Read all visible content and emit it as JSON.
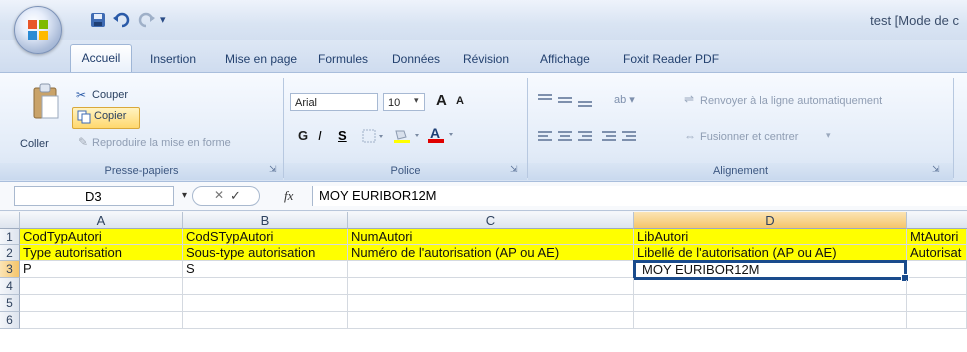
{
  "titlebar": {
    "title": "test [Mode de c",
    "qa_sep": "▾"
  },
  "tabs": [
    "Accueil",
    "Insertion",
    "Mise en page",
    "Formules",
    "Données",
    "Révision",
    "Affichage",
    "Foxit Reader PDF"
  ],
  "ribbon": {
    "clipboard": {
      "paste": "Coller",
      "cut": "Couper",
      "copy": "Copier",
      "format_painter": "Reproduire la mise en forme",
      "label": "Presse-papiers"
    },
    "font": {
      "name": "Arial",
      "size": "10",
      "grow": "A",
      "shrink": "A",
      "bold": "G",
      "italic": "I",
      "underline": "S",
      "label": "Police"
    },
    "alignment": {
      "wrap": "Renvoyer à la ligne automatiquement",
      "merge": "Fusionner et centrer",
      "label": "Alignement"
    }
  },
  "formula": {
    "cell_ref": "D3",
    "cancel": "✕",
    "enter": "✓",
    "fx": "fx",
    "value": "MOY EURIBOR12M"
  },
  "columns": [
    "A",
    "B",
    "C",
    "D"
  ],
  "rows": [
    "1",
    "2",
    "3",
    "4",
    "5",
    "6"
  ],
  "cells": {
    "r1": [
      "CodTypAutori",
      "CodSTypAutori",
      "NumAutori",
      "LibAutori",
      "MtAutori"
    ],
    "r2": [
      "Type autorisation",
      "Sous-type autorisation",
      "Numéro de l'autorisation (AP ou AE)",
      "Libellé de l'autorisation (AP ou AE)",
      "Autorisat"
    ],
    "r3": [
      "P",
      "S",
      "",
      "MOY EURIBOR12M",
      ""
    ]
  }
}
